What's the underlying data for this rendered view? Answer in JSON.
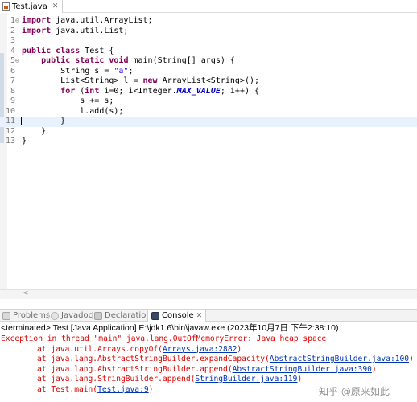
{
  "editor": {
    "tab": {
      "title": "Test.java",
      "close_icon": "✕"
    },
    "lines": [
      {
        "num": "1",
        "fold": "⊖",
        "tokens": [
          {
            "t": "kw",
            "v": "import"
          },
          {
            "t": "p",
            "v": " java.util.ArrayList;"
          }
        ]
      },
      {
        "num": "2",
        "fold": "",
        "tokens": [
          {
            "t": "kw",
            "v": "import"
          },
          {
            "t": "p",
            "v": " java.util.List;"
          }
        ]
      },
      {
        "num": "3",
        "fold": "",
        "tokens": []
      },
      {
        "num": "4",
        "fold": "",
        "tokens": [
          {
            "t": "kw",
            "v": "public class"
          },
          {
            "t": "p",
            "v": " Test {"
          }
        ]
      },
      {
        "num": "5",
        "fold": "⊖",
        "tokens": [
          {
            "t": "p",
            "v": "    "
          },
          {
            "t": "kw",
            "v": "public static void"
          },
          {
            "t": "p",
            "v": " main(String[] args) {"
          }
        ]
      },
      {
        "num": "6",
        "fold": "",
        "tokens": [
          {
            "t": "p",
            "v": "        String s = "
          },
          {
            "t": "str",
            "v": "\"a\""
          },
          {
            "t": "p",
            "v": ";"
          }
        ]
      },
      {
        "num": "7",
        "fold": "",
        "tokens": [
          {
            "t": "p",
            "v": "        List<String> l = "
          },
          {
            "t": "kw",
            "v": "new"
          },
          {
            "t": "p",
            "v": " ArrayList<String>();"
          }
        ]
      },
      {
        "num": "8",
        "fold": "",
        "tokens": [
          {
            "t": "p",
            "v": "        "
          },
          {
            "t": "kw",
            "v": "for"
          },
          {
            "t": "p",
            "v": " ("
          },
          {
            "t": "kw",
            "v": "int"
          },
          {
            "t": "p",
            "v": " i=0; i<Integer."
          },
          {
            "t": "cst",
            "v": "MAX_VALUE"
          },
          {
            "t": "p",
            "v": "; i++) {"
          }
        ]
      },
      {
        "num": "9",
        "fold": "",
        "tokens": [
          {
            "t": "p",
            "v": "            s += s;"
          }
        ]
      },
      {
        "num": "10",
        "fold": "",
        "tokens": [
          {
            "t": "p",
            "v": "            l.add(s);"
          }
        ]
      },
      {
        "num": "11",
        "fold": "",
        "current": true,
        "tokens": [
          {
            "t": "p",
            "v": "        }"
          }
        ]
      },
      {
        "num": "12",
        "fold": "",
        "tokens": [
          {
            "t": "p",
            "v": "    }"
          }
        ]
      },
      {
        "num": "13",
        "fold": "",
        "tokens": [
          {
            "t": "p",
            "v": "}"
          }
        ]
      }
    ],
    "hscroll_icon": "<"
  },
  "panel": {
    "tabs": [
      {
        "label": "Problems",
        "icon": "problems-icon",
        "active": false
      },
      {
        "label": "Javadoc",
        "icon": "javadoc-icon",
        "active": false
      },
      {
        "label": "Declaration",
        "icon": "declaration-icon",
        "active": false
      },
      {
        "label": "Console",
        "icon": "console-icon",
        "active": true,
        "close_icon": "✕"
      }
    ]
  },
  "console": {
    "header": "<terminated> Test [Java Application] E:\\jdk1.6\\bin\\javaw.exe (2023年10月7日 下午2:38:10)",
    "error_color": "#d90000",
    "link_color": "#0033b3",
    "lines": [
      {
        "indent": false,
        "text": "Exception in thread \"main\" java.lang.OutOfMemoryError: Java heap space",
        "link": "",
        "suffix": ""
      },
      {
        "indent": true,
        "text": "at java.util.Arrays.copyOf(",
        "link": "Arrays.java:2882",
        "suffix": ")"
      },
      {
        "indent": true,
        "text": "at java.lang.AbstractStringBuilder.expandCapacity(",
        "link": "AbstractStringBuilder.java:100",
        "suffix": ")"
      },
      {
        "indent": true,
        "text": "at java.lang.AbstractStringBuilder.append(",
        "link": "AbstractStringBuilder.java:390",
        "suffix": ")"
      },
      {
        "indent": true,
        "text": "at java.lang.StringBuilder.append(",
        "link": "StringBuilder.java:119",
        "suffix": ")"
      },
      {
        "indent": true,
        "text": "at Test.main(",
        "link": "Test.java:9",
        "suffix": ")"
      }
    ]
  },
  "watermark": "知乎 @原来如此"
}
